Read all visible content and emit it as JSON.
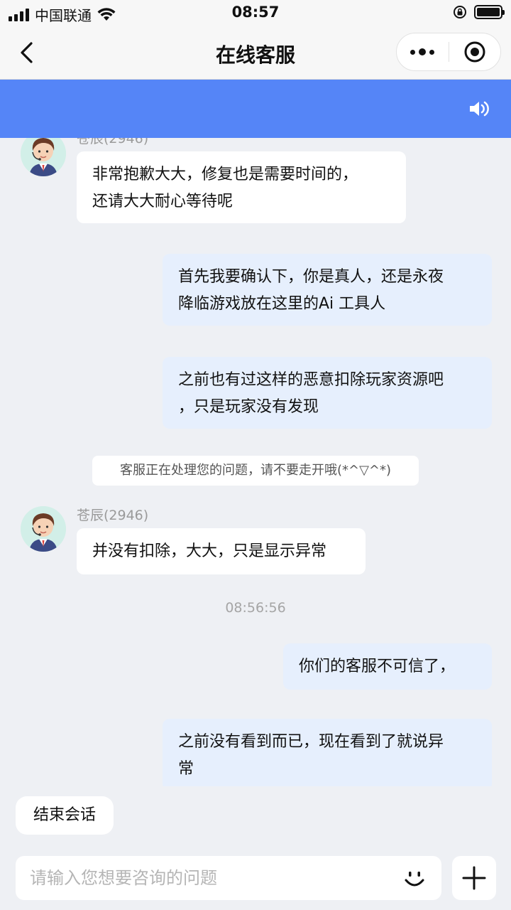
{
  "status_bar": {
    "carrier": "中国联通",
    "time": "08:57"
  },
  "nav": {
    "title": "在线客服"
  },
  "banner": {
    "icon": "speaker-icon"
  },
  "chat": {
    "agent_name": "苍辰(2946)",
    "messages": [
      {
        "side": "in",
        "text_line1": "非常抱歉大大，修复也是需要时间的，",
        "text_line2": "还请大大耐心等待呢"
      },
      {
        "side": "out",
        "text_line1": "首先我要确认下，你是真人，还是永夜",
        "text_line2": "降临游戏放在这里的Ai 工具人"
      },
      {
        "side": "out",
        "text_line1": "之前也有过这样的恶意扣除玩家资源吧",
        "text_line2": "，只是玩家没有发现"
      },
      {
        "side": "system",
        "text": "客服正在处理您的问题，请不要走开哦(*^▽^*)"
      },
      {
        "side": "in",
        "text": "并没有扣除，大大，只是显示异常"
      },
      {
        "side": "timestamp",
        "text": "08:56:56"
      },
      {
        "side": "out",
        "text": "你们的客服不可信了，"
      },
      {
        "side": "out",
        "text_line1": "之前没有看到而已，现在看到了就说异",
        "text_line2": "常"
      }
    ]
  },
  "bottom": {
    "end_session_label": "结束会话",
    "input_placeholder": "请输入您想要咨询的问题",
    "input_value": ""
  },
  "colors": {
    "banner": "#5585f7",
    "outgoing_bubble": "#e6effd",
    "incoming_bubble": "#ffffff",
    "background": "#eef0f4"
  }
}
